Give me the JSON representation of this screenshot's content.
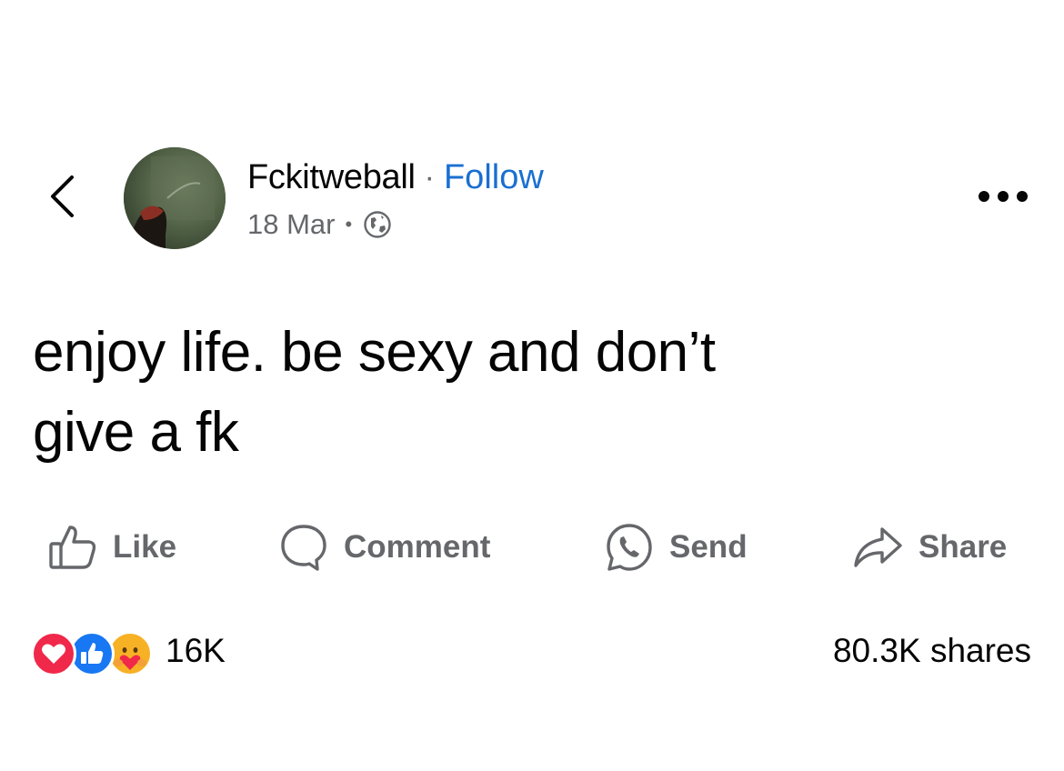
{
  "header": {
    "author_name": "Fckitweball",
    "separator": "·",
    "follow_label": "Follow",
    "date": "18 Mar",
    "meta_separator": "•",
    "privacy_icon": "globe-icon",
    "back_icon": "chevron-left-icon",
    "more_icon": "more-options-icon"
  },
  "post": {
    "text": "enjoy life. be sexy and don’t\ngive a fk"
  },
  "actions": {
    "like_label": "Like",
    "comment_label": "Comment",
    "send_label": "Send",
    "share_label": "Share"
  },
  "stats": {
    "reactions": [
      "love",
      "like",
      "care"
    ],
    "reaction_count": "16K",
    "shares": "80.3K shares"
  },
  "colors": {
    "link": "#1a6fd1",
    "secondary_text": "#65676b",
    "primary_text": "#050505",
    "love": "#f0284a",
    "like": "#1877f2",
    "care": "#f7b125"
  }
}
